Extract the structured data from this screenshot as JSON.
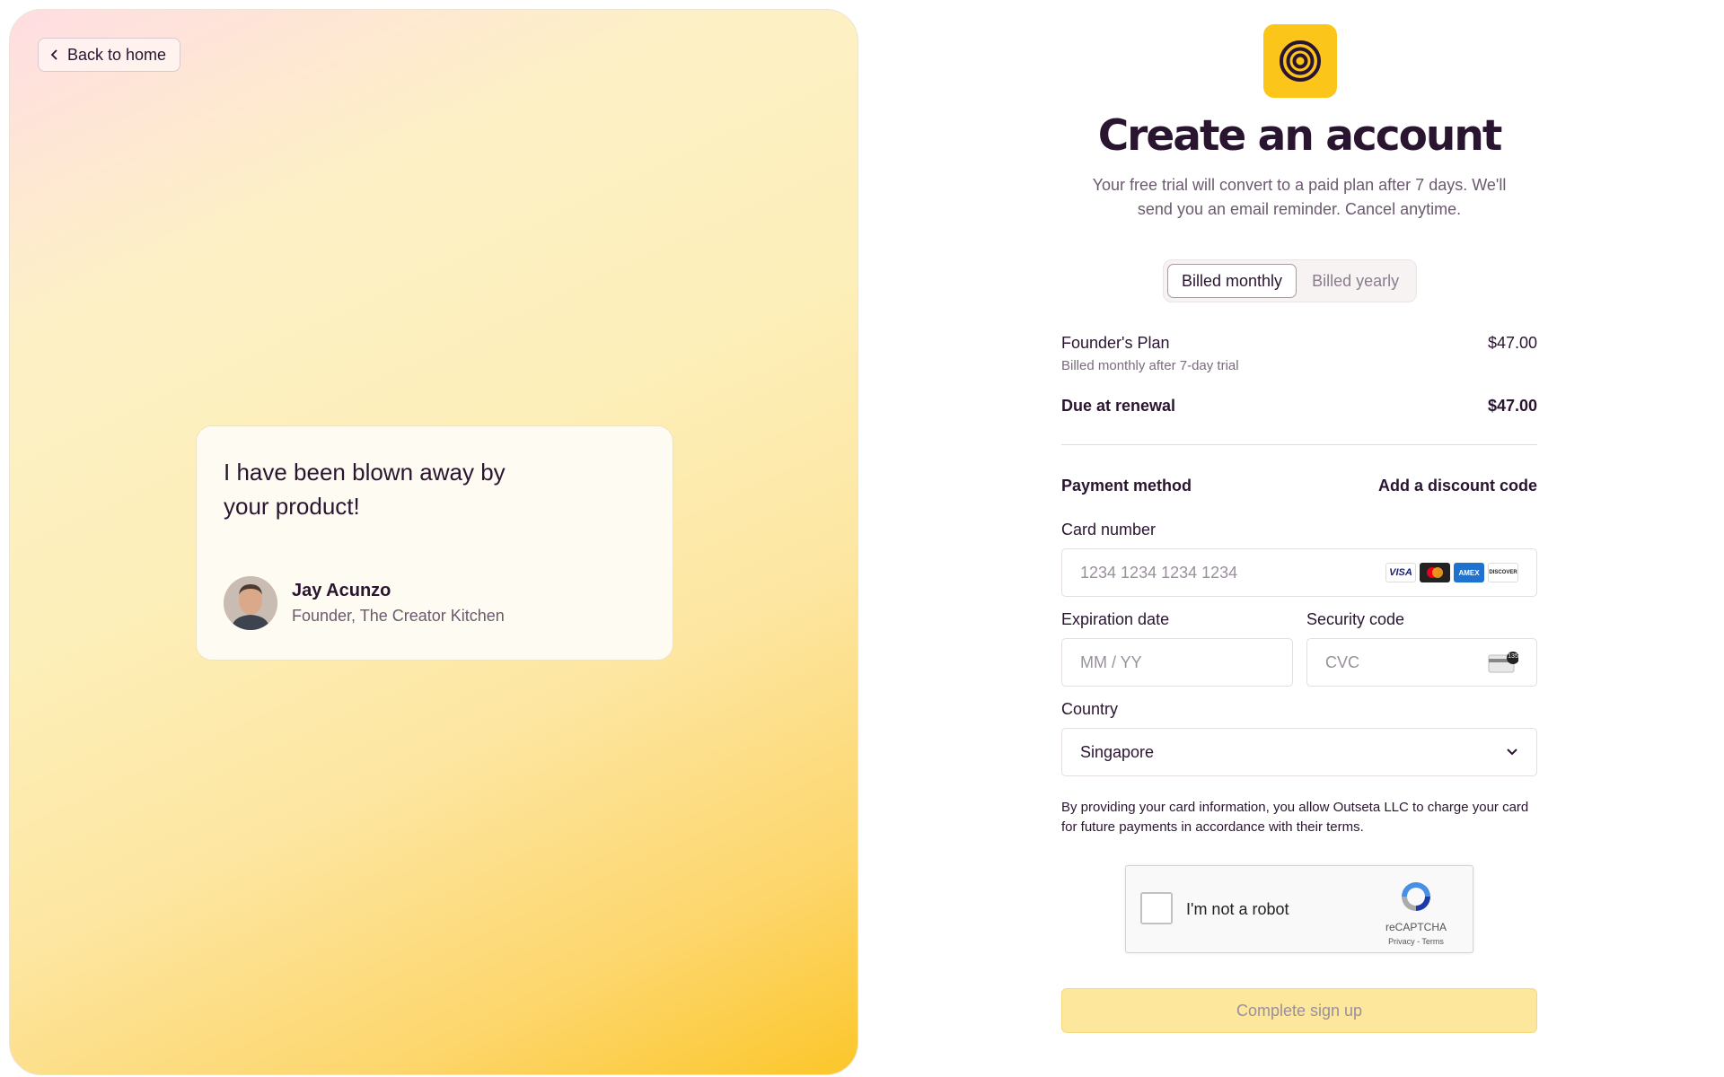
{
  "hero": {
    "back_label": "Back to home",
    "quote": "I have been blown away by your product!",
    "author_name": "Jay Acunzo",
    "author_role": "Founder, The Creator Kitchen"
  },
  "signup": {
    "title": "Create an account",
    "subtitle": "Your free trial will convert to a paid plan after 7 days. We'll send you an email reminder. Cancel anytime.",
    "billing_options": [
      {
        "label": "Billed monthly",
        "selected": true
      },
      {
        "label": "Billed yearly",
        "selected": false
      }
    ],
    "plan_name": "Founder's Plan",
    "plan_note": "Billed monthly after 7-day trial",
    "plan_price": "$47.00",
    "renewal_label": "Due at renewal",
    "renewal_price": "$47.00",
    "payment_label": "Payment method",
    "discount_link": "Add a discount code",
    "card_number_label": "Card number",
    "card_number_placeholder": "1234 1234 1234 1234",
    "card_brands": [
      "VISA",
      "mastercard",
      "AMEX",
      "DISCOVER"
    ],
    "expiry_label": "Expiration date",
    "expiry_placeholder": "MM / YY",
    "cvc_label": "Security code",
    "cvc_placeholder": "CVC",
    "cvc_badge": "135",
    "country_label": "Country",
    "country_value": "Singapore",
    "disclaimer": "By providing your card information, you allow Outseta LLC to charge your card for future payments in accordance with their terms.",
    "captcha": {
      "label": "I'm not a robot",
      "brand": "reCAPTCHA",
      "links": "Privacy - Terms"
    },
    "submit_label": "Complete sign up"
  },
  "colors": {
    "brand_yellow": "#fbc619",
    "text_dark": "#2a1530",
    "submit_disabled": "#fde79c"
  }
}
